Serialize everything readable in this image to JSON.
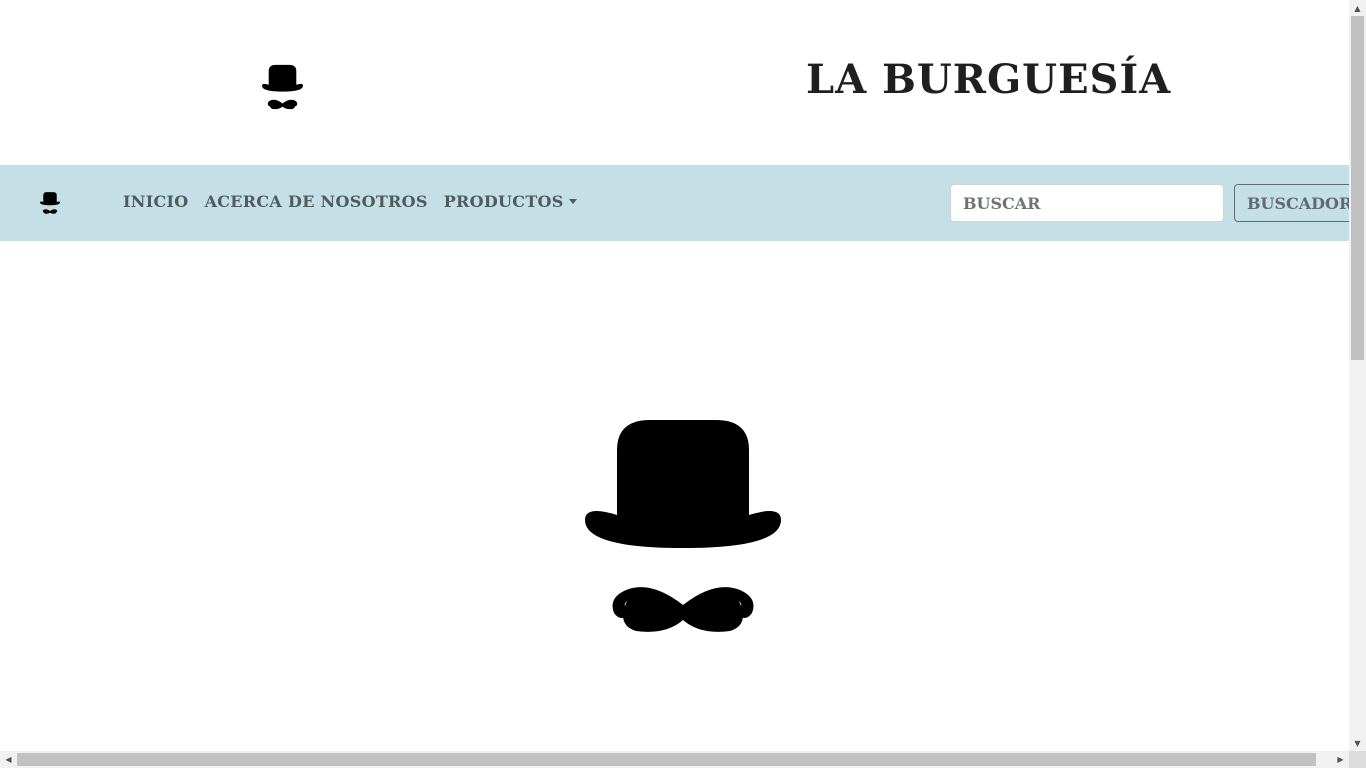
{
  "header": {
    "title": "LA BURGUESÍA",
    "logo_icon": "bowler-hat-mustache-icon"
  },
  "navbar": {
    "brand_icon": "bowler-hat-mustache-icon",
    "links": [
      {
        "label": "INICIO"
      },
      {
        "label": "ACERCA DE NOSOTROS"
      },
      {
        "label": "PRODUCTOS",
        "has_dropdown": true
      }
    ],
    "search": {
      "placeholder": "BUSCAR",
      "button_label": "BUSCADOR"
    },
    "background_color": "#c4dfe6"
  },
  "hero": {
    "logo_icon": "bowler-hat-mustache-icon"
  },
  "scrollbar_icons": {
    "up": "▲",
    "down": "▼",
    "left": "◀",
    "right": "▶"
  }
}
